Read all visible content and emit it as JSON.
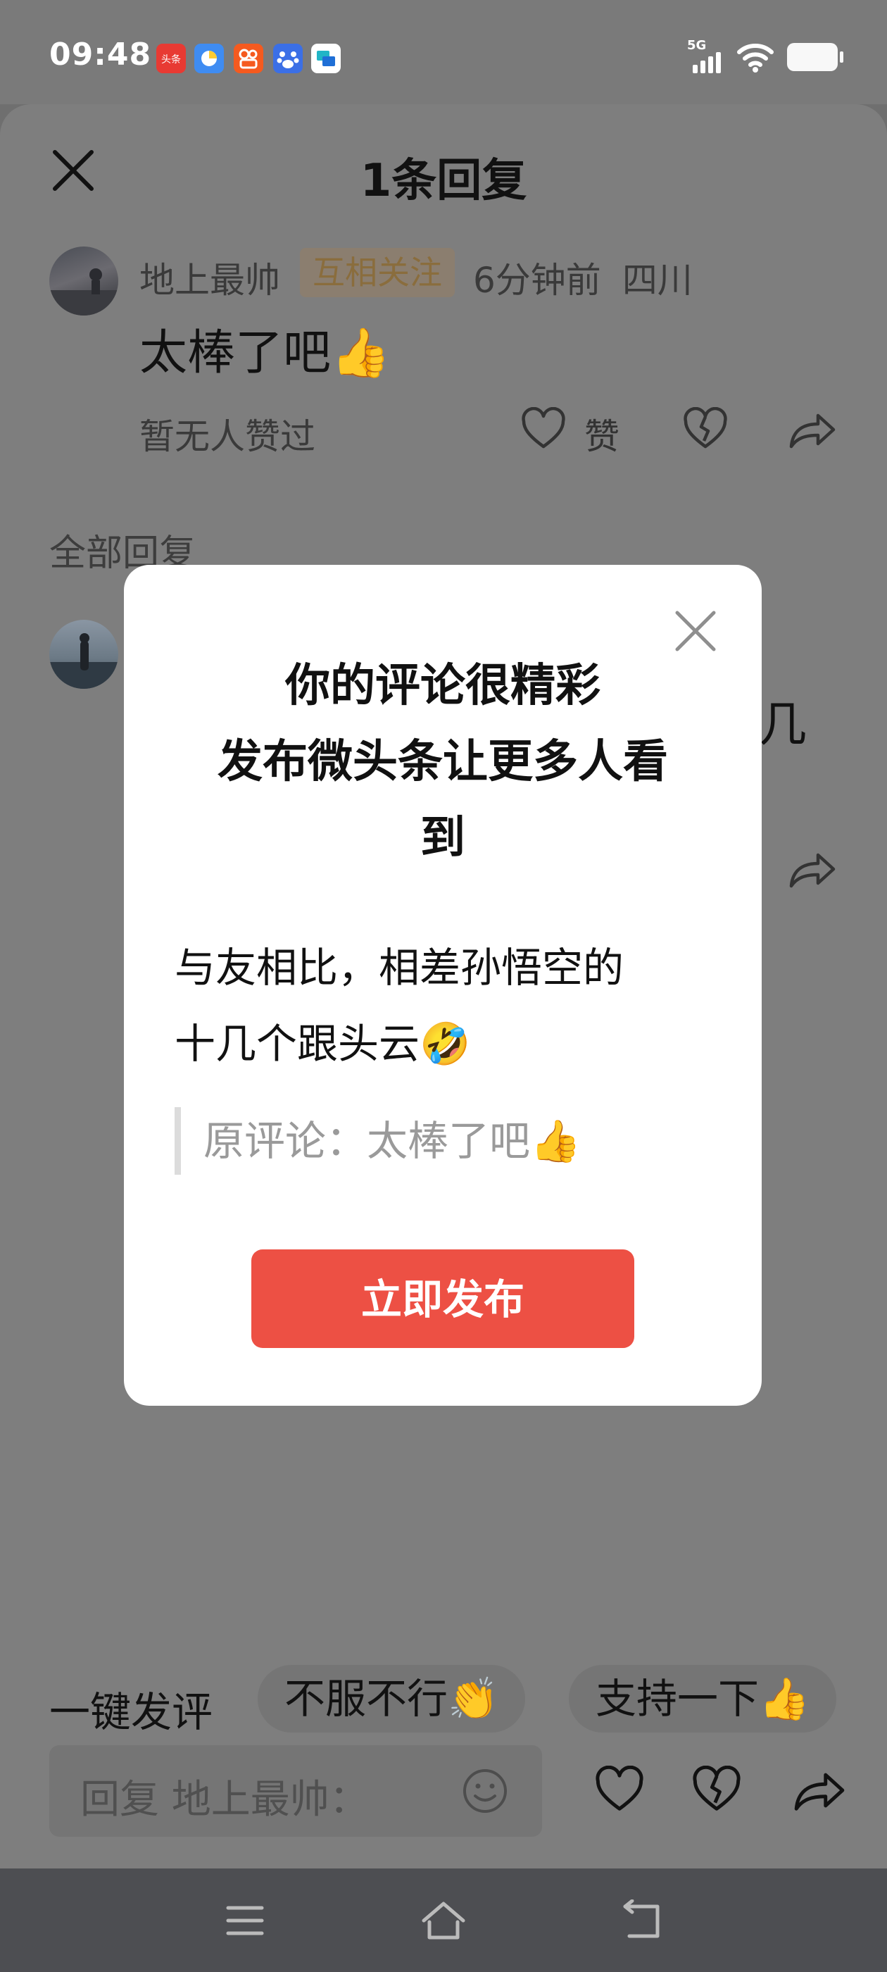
{
  "status_bar": {
    "time": "09:48",
    "network": "5G",
    "notification_icons": [
      {
        "name": "toutiao-app-icon",
        "label": "头条",
        "color": "#e83a33"
      },
      {
        "name": "browser-app-icon",
        "color": "#3f8cf2"
      },
      {
        "name": "kuaishou-app-icon",
        "color": "#f55a1f"
      },
      {
        "name": "baidu-app-icon",
        "color": "#3b6fe6"
      },
      {
        "name": "feishu-app-icon",
        "color": "#21b5c6"
      }
    ]
  },
  "header": {
    "title": "1条回复"
  },
  "comment": {
    "username": "地上最帅",
    "badge": "互相关注",
    "time_ago": "6分钟前",
    "location": "四川",
    "text": "太棒了吧👍",
    "likes_text": "暂无人赞过",
    "like_label": "赞"
  },
  "replies_section": {
    "title": "全部回复",
    "partial_text": "几"
  },
  "modal": {
    "title_line1": "你的评论很精彩",
    "title_line2": "发布微头条让更多人看",
    "title_line3": "到",
    "body_line1": "与友相比，相差孙悟空的",
    "body_line2": "十几个跟头云🤣",
    "original_comment": "原评论：太棒了吧👍",
    "publish_button": "立即发布"
  },
  "quick_reply": {
    "label": "一键发评",
    "chips": [
      "不服不行👏",
      "支持一下👍"
    ]
  },
  "reply_input": {
    "placeholder": "回复 地上最帅："
  },
  "colors": {
    "accent": "#ed5044",
    "overlay_bg": "#7e7e7e",
    "nav_bar": "#4d4e52"
  }
}
